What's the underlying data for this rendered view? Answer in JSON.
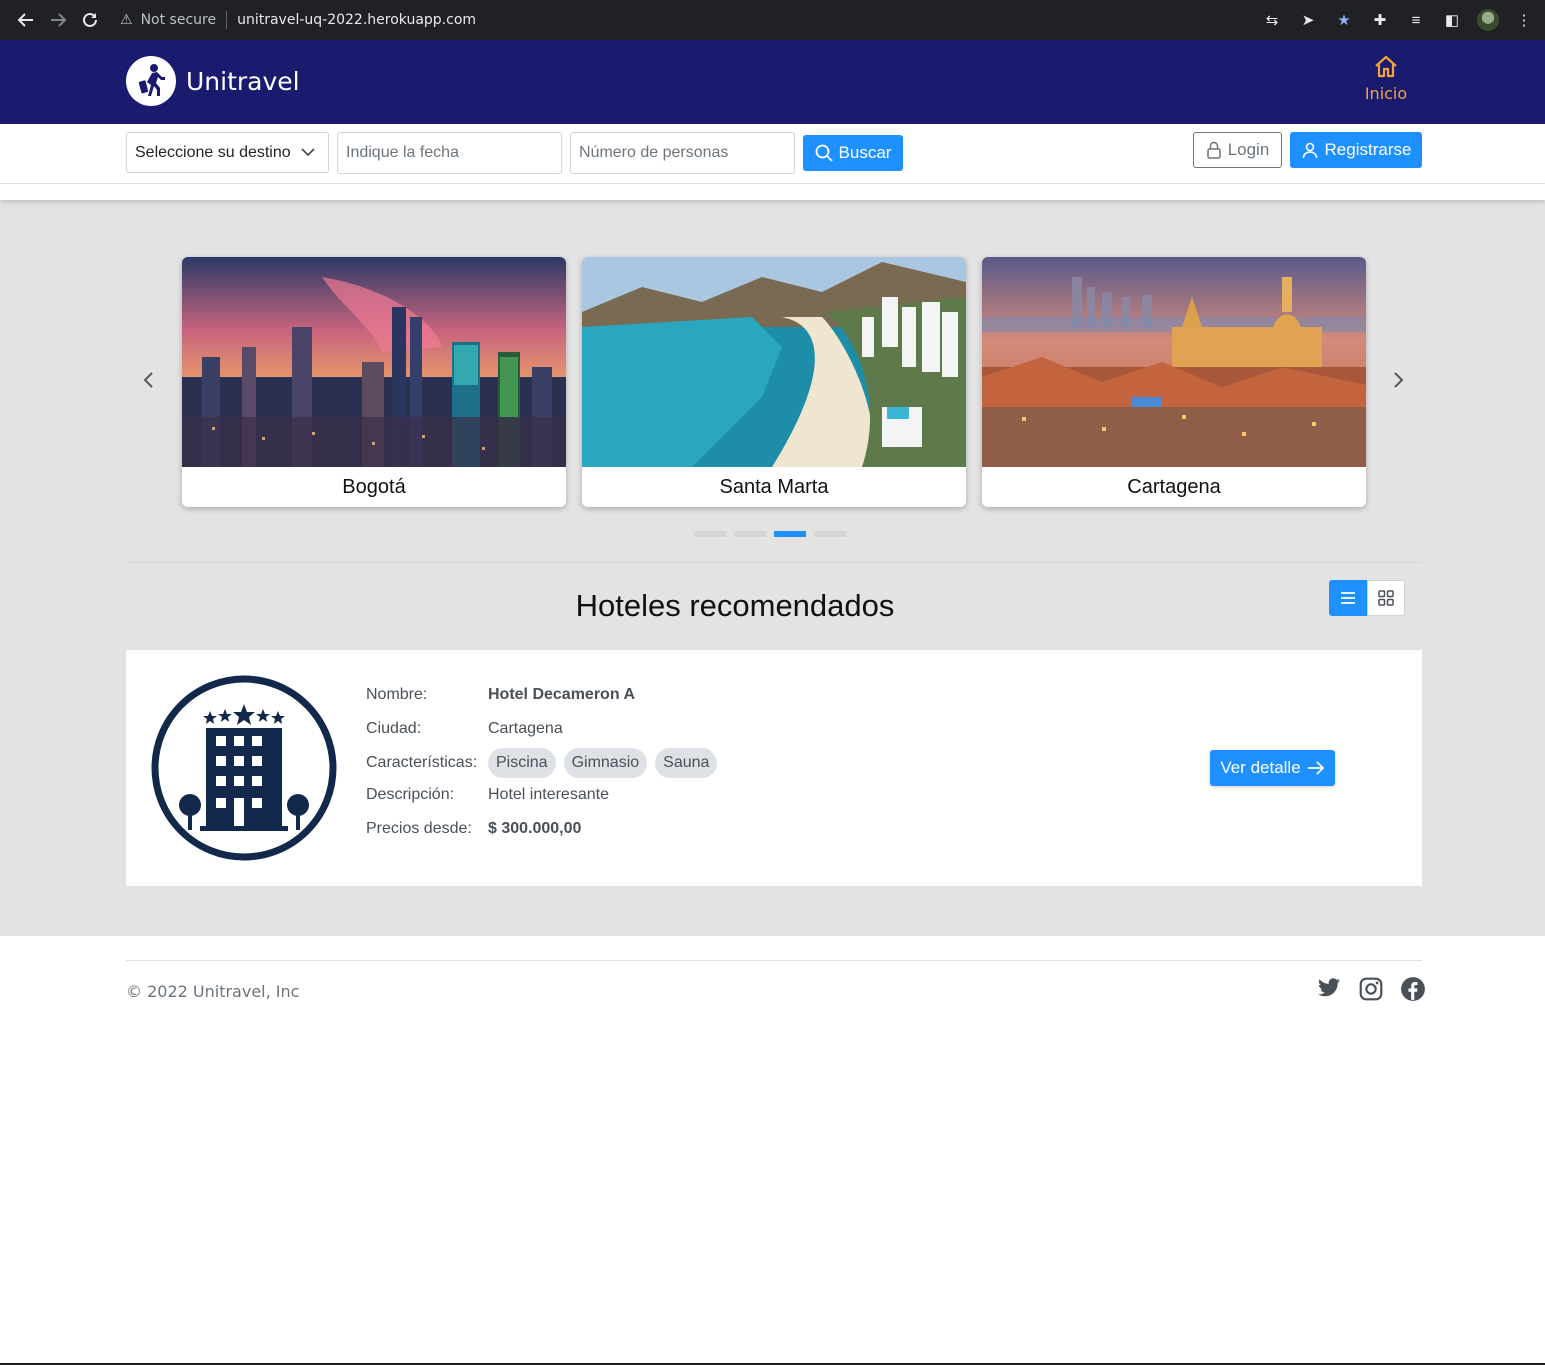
{
  "browser": {
    "security_label": "Not secure",
    "url": "unitravel-uq-2022.herokuapp.com"
  },
  "header": {
    "brand": "Unitravel",
    "nav_home": "Inicio"
  },
  "search": {
    "destination_label": "Seleccione su destino",
    "date_placeholder": "Indique la fecha",
    "people_placeholder": "Número de personas",
    "search_button": "Buscar",
    "login_button": "Login",
    "register_button": "Registrarse"
  },
  "carousel": {
    "cards": [
      {
        "label": "Bogotá"
      },
      {
        "label": "Santa Marta"
      },
      {
        "label": "Cartagena"
      }
    ],
    "active_page": 3,
    "page_count": 4
  },
  "hotels": {
    "title": "Hoteles recomendados",
    "items": [
      {
        "name_label": "Nombre:",
        "name": "Hotel Decameron A",
        "city_label": "Ciudad:",
        "city": "Cartagena",
        "features_label": "Características:",
        "features": [
          "Piscina",
          "Gimnasio",
          "Sauna"
        ],
        "description_label": "Descripción:",
        "description": "Hotel interesante",
        "price_label": "Precios desde:",
        "price": "$ 300.000,00",
        "detail_button": "Ver detalle"
      }
    ]
  },
  "footer": {
    "copyright": "© 2022 Unitravel, Inc",
    "socials": [
      "twitter-icon",
      "instagram-icon",
      "facebook-icon"
    ]
  },
  "colors": {
    "header_bg": "#1a1b6e",
    "accent": "#1e90ff",
    "nav_home": "#f2a33a",
    "page_bg": "#e3e3e3",
    "hotel_logo": "#13294b"
  }
}
